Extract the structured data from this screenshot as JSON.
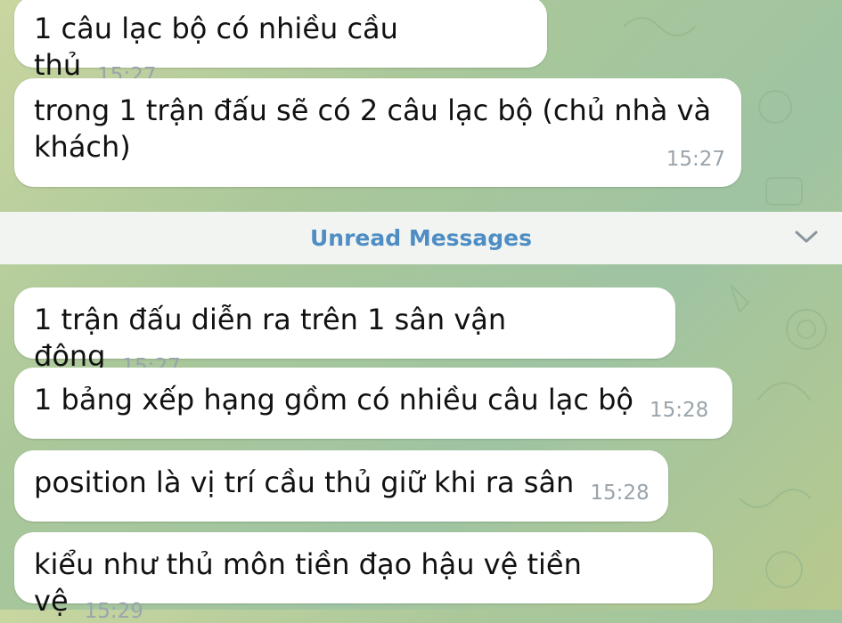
{
  "messages_before": [
    {
      "text": "1 câu lạc bộ có nhiều cầu thủ",
      "time": "15:27"
    },
    {
      "text": "trong 1 trận đấu sẽ có 2 câu lạc bộ (chủ nhà và khách)",
      "time": "15:27"
    }
  ],
  "unread_divider": {
    "label": "Unread Messages",
    "icon": "chevron-down-icon"
  },
  "messages_after": [
    {
      "text": "1 trận đấu diễn ra trên 1 sân vận động",
      "time": "15:27"
    },
    {
      "text": "1 bảng xếp hạng gồm có nhiều câu lạc bộ",
      "time": "15:28"
    },
    {
      "text": "position là vị trí cầu thủ giữ khi ra sân",
      "time": "15:28"
    },
    {
      "text": "kiểu như thủ môn tiền đạo hậu vệ tiền vệ",
      "time": "15:29"
    }
  ],
  "colors": {
    "accent": "#4e8ec4",
    "bubble": "#ffffff",
    "timestamp": "#9aa4ab"
  }
}
